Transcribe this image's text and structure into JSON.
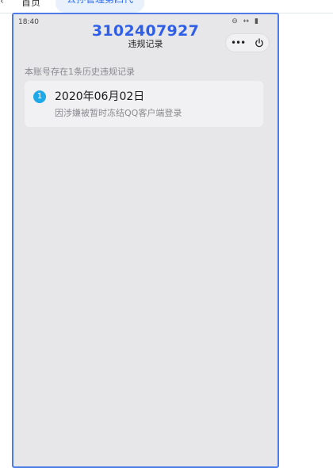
{
  "tabs": {
    "chevron": "‹",
    "home": "首页",
    "active": "公孙管理第四代"
  },
  "phone": {
    "status_time": "18:40",
    "status_icons": "⊖ ↔ ▮",
    "header_number": "3102407927",
    "header_subtitle": "违规记录",
    "more_label": "•••"
  },
  "content": {
    "note": "本账号存在1条历史违规记录",
    "records": [
      {
        "index": "1",
        "date": "2020年06月02日",
        "reason": "因涉嫌被暂时冻结QQ客户端登录"
      }
    ]
  },
  "colors": {
    "accent": "#2f5fe6",
    "badge": "#1fa8e8",
    "phone_border": "#4d7be8",
    "background": "#e7e7ea"
  }
}
